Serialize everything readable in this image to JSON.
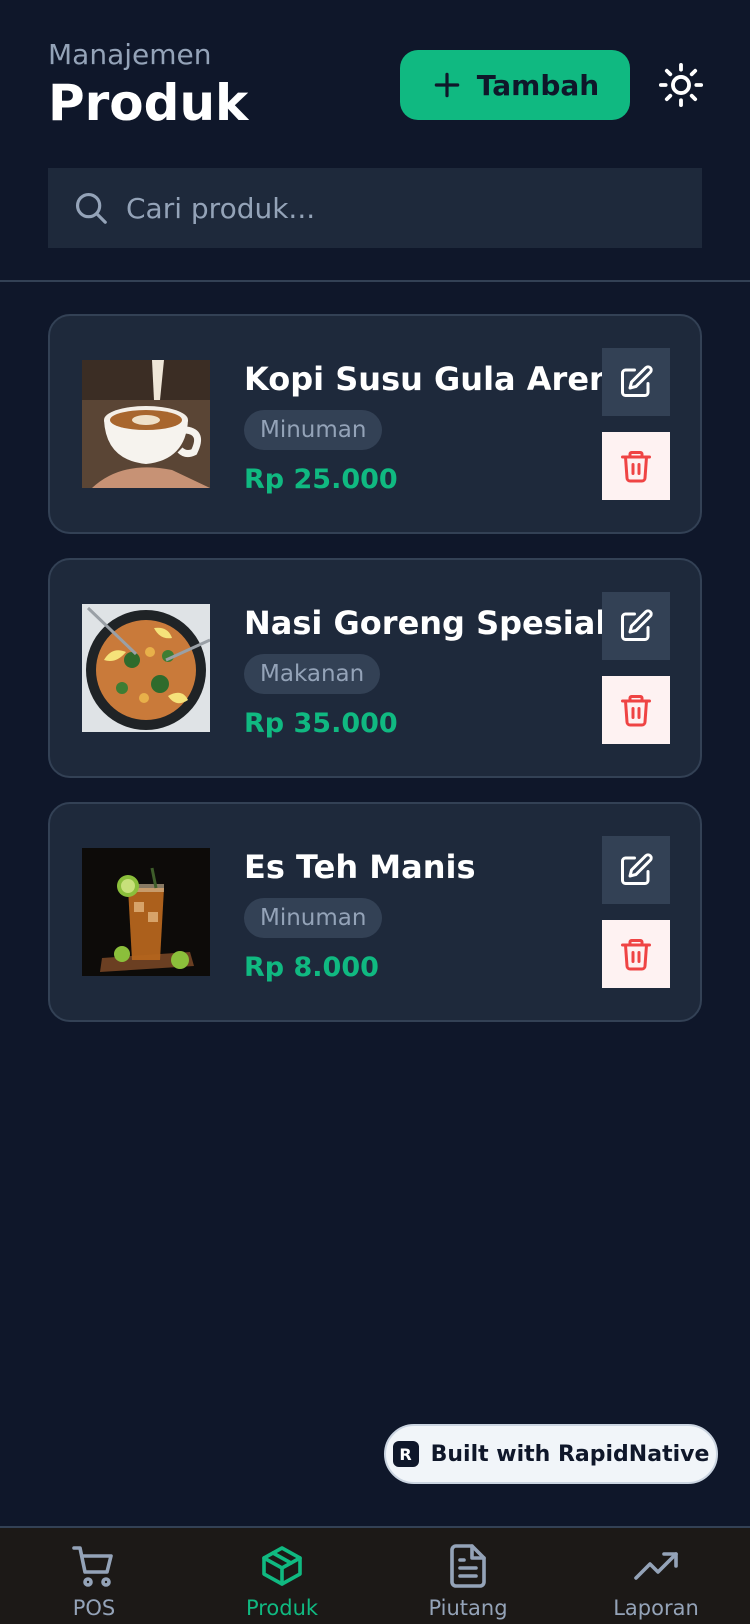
{
  "header": {
    "subtitle": "Manajemen",
    "title": "Produk",
    "add_label": "Tambah"
  },
  "search": {
    "placeholder": "Cari produk..."
  },
  "products": [
    {
      "name": "Kopi Susu Gula Aren",
      "category": "Minuman",
      "price": "Rp 25.000"
    },
    {
      "name": "Nasi Goreng Spesial",
      "category": "Makanan",
      "price": "Rp 35.000"
    },
    {
      "name": "Es Teh Manis",
      "category": "Minuman",
      "price": "Rp 8.000"
    }
  ],
  "badge": {
    "label": "Built with RapidNative"
  },
  "tabs": [
    {
      "label": "POS",
      "icon": "cart-icon"
    },
    {
      "label": "Produk",
      "icon": "package-icon",
      "active": true
    },
    {
      "label": "Piutang",
      "icon": "document-icon"
    },
    {
      "label": "Laporan",
      "icon": "trending-up-icon"
    }
  ],
  "colors": {
    "background": "#0f172a",
    "card": "#1e293b",
    "accent": "#10b981",
    "muted": "#94a3b8",
    "danger": "#ef4444"
  }
}
